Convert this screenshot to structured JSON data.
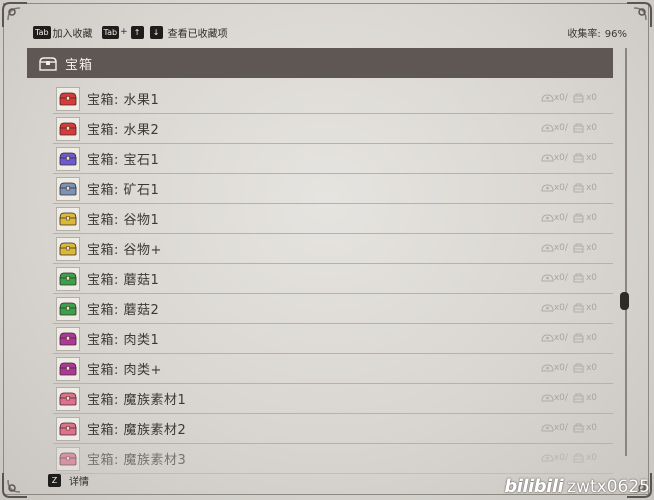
{
  "hints": {
    "tab_key": "Tab",
    "favorite_label": "加入收藏",
    "up_key": "↑",
    "down_key": "↓",
    "view_favorites_label": "查看已收藏项",
    "plus": "+"
  },
  "collection": {
    "label": "收集率:",
    "value": "96%"
  },
  "category": {
    "title": "宝箱",
    "icon": "treasure-chest-icon"
  },
  "items": [
    {
      "label": "宝箱: 水果1",
      "color": "#d83a3a",
      "count_a": "x0/",
      "count_b": "x0",
      "dim": false
    },
    {
      "label": "宝箱: 水果2",
      "color": "#d83a3a",
      "count_a": "x0/",
      "count_b": "x0",
      "dim": false
    },
    {
      "label": "宝箱: 宝石1",
      "color": "#6b5ad0",
      "count_a": "x0/",
      "count_b": "x0",
      "dim": false
    },
    {
      "label": "宝箱: 矿石1",
      "color": "#7a93b8",
      "count_a": "x0/",
      "count_b": "x0",
      "dim": false
    },
    {
      "label": "宝箱: 谷物1",
      "color": "#d9b83a",
      "count_a": "x0/",
      "count_b": "x0",
      "dim": false
    },
    {
      "label": "宝箱: 谷物+",
      "color": "#d9b83a",
      "count_a": "x0/",
      "count_b": "x0",
      "dim": false
    },
    {
      "label": "宝箱: 蘑菇1",
      "color": "#3aa24a",
      "count_a": "x0/",
      "count_b": "x0",
      "dim": false
    },
    {
      "label": "宝箱: 蘑菇2",
      "color": "#3aa24a",
      "count_a": "x0/",
      "count_b": "x0",
      "dim": false
    },
    {
      "label": "宝箱: 肉类1",
      "color": "#b0379a",
      "count_a": "x0/",
      "count_b": "x0",
      "dim": false
    },
    {
      "label": "宝箱: 肉类+",
      "color": "#b0379a",
      "count_a": "x0/",
      "count_b": "x0",
      "dim": false
    },
    {
      "label": "宝箱: 魔族素材1",
      "color": "#e0708e",
      "count_a": "x0/",
      "count_b": "x0",
      "dim": false
    },
    {
      "label": "宝箱: 魔族素材2",
      "color": "#e0708e",
      "count_a": "x0/",
      "count_b": "x0",
      "dim": false
    },
    {
      "label": "宝箱: 魔族素材3",
      "color": "#e0708e",
      "count_a": "x0/",
      "count_b": "x0",
      "dim": true
    }
  ],
  "bottom": {
    "key": "Z",
    "details_label": "详情"
  },
  "watermark": {
    "logo": "bilibili",
    "user": "zwtx0625"
  }
}
